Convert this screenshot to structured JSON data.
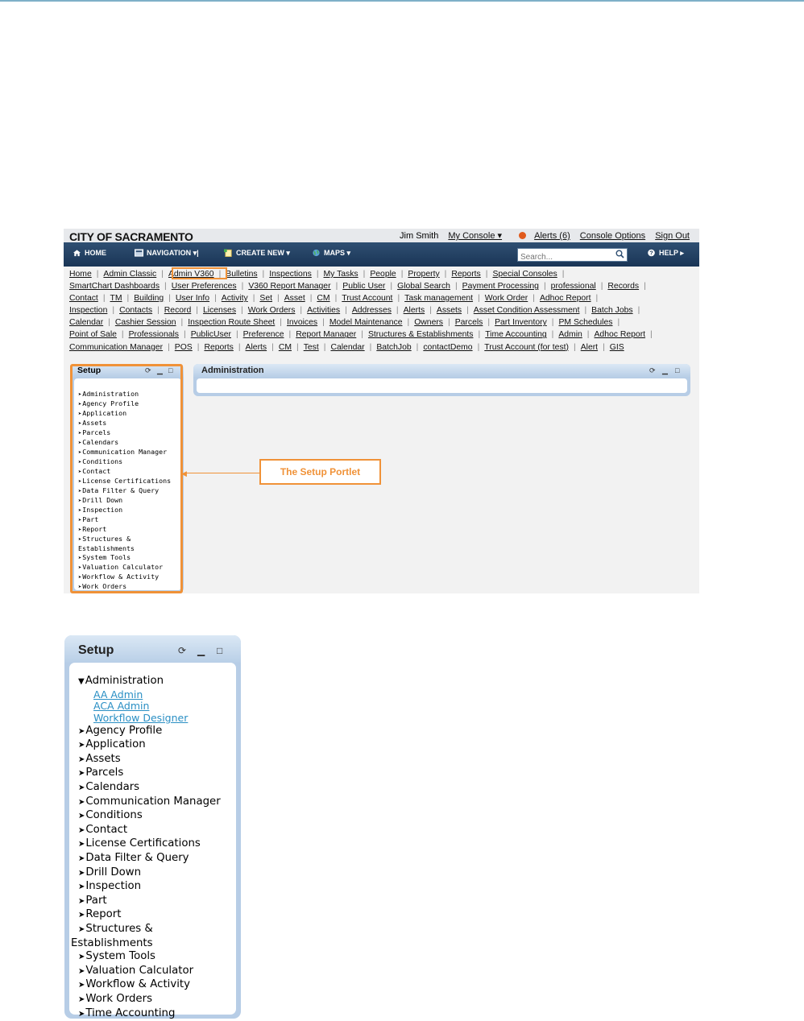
{
  "header": {
    "brand": "CITY OF SACRAMENTO",
    "user": "Jim Smith",
    "my_console": "My Console ▾",
    "alerts": "Alerts (6)",
    "console_options": "Console Options",
    "sign_out": "Sign Out"
  },
  "navbar": {
    "home": "HOME",
    "navigation": "NAVIGATION ▾|",
    "create_new": "CREATE NEW ▾",
    "maps": "MAPS ▾",
    "search_placeholder": "Search...",
    "help": "HELP ▸"
  },
  "link_rows": [
    [
      "Home",
      "Admin Classic",
      "Admin V360",
      "Bulletins",
      "Inspections",
      "My Tasks",
      "People",
      "Property",
      "Reports",
      "Special Consoles"
    ],
    [
      "SmartChart Dashboards",
      "User Preferences",
      "V360 Report Manager",
      "Public User",
      "Global Search",
      "Payment Processing",
      "professional",
      "Records"
    ],
    [
      "Contact",
      "TM",
      "Building",
      "User Info",
      "Activity",
      "Set",
      "Asset",
      "CM",
      "Trust Account",
      "Task management",
      "Work Order",
      "Adhoc Report"
    ],
    [
      "Inspection",
      "Contacts",
      "Record",
      "Licenses",
      "Work Orders",
      "Activities",
      "Addresses",
      "Alerts",
      "Assets",
      "Asset Condition Assessment",
      "Batch Jobs"
    ],
    [
      "Calendar",
      "Cashier Session",
      "Inspection Route Sheet",
      "Invoices",
      "Model Maintenance",
      "Owners",
      "Parcels",
      "Part Inventory",
      "PM Schedules"
    ],
    [
      "Point of Sale",
      "Professionals",
      "PublicUser",
      "Preference",
      "Report Manager",
      "Structures & Establishments",
      "Time Accounting",
      "Admin",
      "Adhoc Report"
    ],
    [
      "Communication Manager",
      "POS",
      "Reports",
      "Alerts",
      "CM",
      "Test",
      "Calendar",
      "BatchJob",
      "contactDemo",
      "Trust Account (for test)",
      "Alert",
      "GIS"
    ]
  ],
  "setup_portlet": {
    "title": "Setup",
    "items": [
      "Administration",
      "Agency Profile",
      "Application",
      "Assets",
      "Parcels",
      "Calendars",
      "Communication Manager",
      "Conditions",
      "Contact",
      "License Certifications",
      "Data Filter & Query",
      "Drill Down",
      "Inspection",
      "Part",
      "Report",
      "Structures & Establishments",
      "System Tools",
      "Valuation Calculator",
      "Workflow & Activity",
      "Work Orders",
      "Time Accounting"
    ]
  },
  "admin_portlet": {
    "title": "Administration"
  },
  "callout": "The Setup Portlet",
  "setup_zoom": {
    "title": "Setup",
    "expanded": "Administration",
    "sub_items": [
      "AA Admin",
      "ACA Admin",
      "Workflow Designer"
    ],
    "items": [
      "Agency Profile",
      "Application",
      "Assets",
      "Parcels",
      "Calendars",
      "Communication Manager",
      "Conditions",
      "Contact",
      "License Certifications",
      "Data Filter & Query",
      "Drill Down",
      "Inspection",
      "Part",
      "Report",
      "Structures &",
      "Establishments",
      "System Tools",
      "Valuation Calculator",
      "Workflow & Activity",
      "Work Orders",
      "Time Accounting"
    ]
  },
  "colors": {
    "accent": "#f09238",
    "nav": "#1f3b5e",
    "portlet": "#b7cde6",
    "link_blue": "#2a8fc4"
  }
}
